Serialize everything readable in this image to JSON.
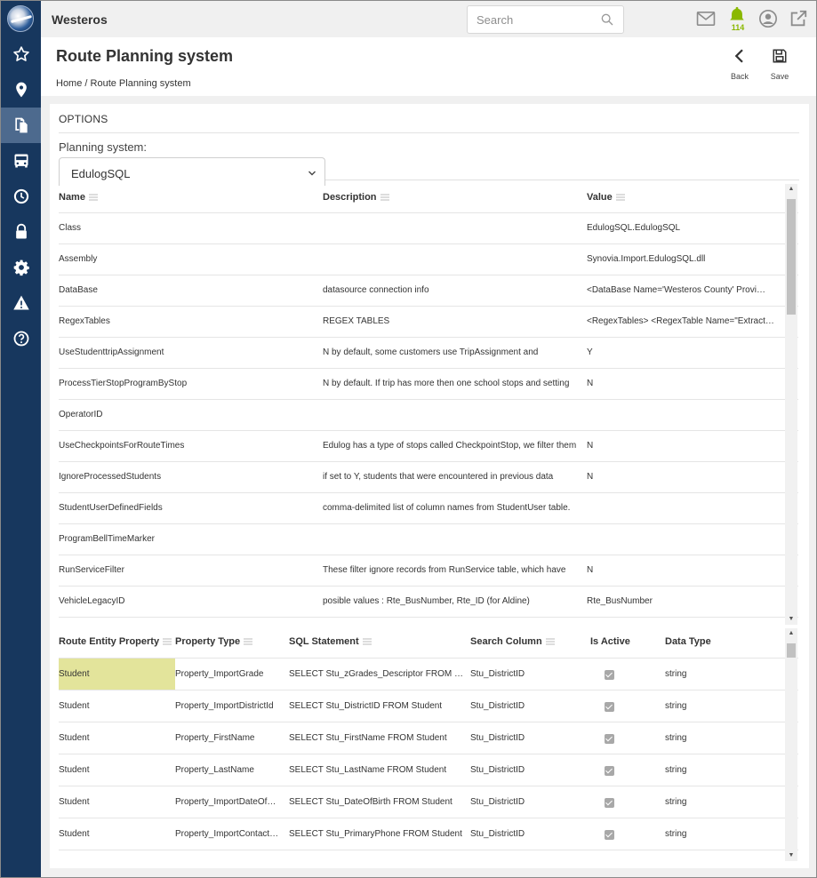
{
  "app": {
    "name": "Westeros"
  },
  "search": {
    "placeholder": "Search"
  },
  "notifications": {
    "count": "114"
  },
  "page": {
    "title": "Route Planning system",
    "breadcrumb": "Home / Route Planning system",
    "back_label": "Back",
    "save_label": "Save"
  },
  "options": {
    "title": "OPTIONS",
    "planning_system_label": "Planning system:",
    "planning_system_value": "EdulogSQL"
  },
  "settings_grid": {
    "columns": [
      "Name",
      "Description",
      "Value"
    ],
    "rows": [
      {
        "name": "Class",
        "description": "",
        "value": "EdulogSQL.EdulogSQL"
      },
      {
        "name": "Assembly",
        "description": "",
        "value": "Synovia.Import.EdulogSQL.dll"
      },
      {
        "name": "DataBase",
        "description": "datasource connection info",
        "value": "<DataBase Name='Westeros County' Provi…"
      },
      {
        "name": "RegexTables",
        "description": "REGEX TABLES",
        "value": "<RegexTables> <RegexTable Name=\"ExtractPr…"
      },
      {
        "name": "UseStudenttripAssignment",
        "description": "N by default, some customers use TripAssignment and",
        "value": "Y"
      },
      {
        "name": "ProcessTierStopProgramByStop",
        "description": "N by default. If trip has more then one school stops and setting",
        "value": "N"
      },
      {
        "name": "OperatorID",
        "description": "",
        "value": ""
      },
      {
        "name": "UseCheckpointsForRouteTimes",
        "description": "Edulog has a type of stops called CheckpointStop, we filter them",
        "value": "N"
      },
      {
        "name": "IgnoreProcessedStudents",
        "description": "if set to Y, students that were encountered in previous data",
        "value": "N"
      },
      {
        "name": "StudentUserDefinedFields",
        "description": "comma-delimited list of column names from StudentUser table.",
        "value": ""
      },
      {
        "name": "ProgramBellTimeMarker",
        "description": "",
        "value": ""
      },
      {
        "name": "RunServiceFilter",
        "description": "These filter ignore records from RunService table, which have",
        "value": "N"
      },
      {
        "name": "VehicleLegacyID",
        "description": "posible values : Rte_BusNumber, Rte_ID (for Aldine)",
        "value": "Rte_BusNumber"
      }
    ]
  },
  "entity_grid": {
    "columns": [
      "Route Entity Property",
      "Property Type",
      "SQL Statement",
      "Search Column",
      "Is Active",
      "Data Type"
    ],
    "rows": [
      {
        "entity": "Student",
        "type": "Property_ImportGrade",
        "sql": "SELECT Stu_zGrades_Descriptor FROM St…",
        "search": "Stu_DistrictID",
        "active": true,
        "datatype": "string"
      },
      {
        "entity": "Student",
        "type": "Property_ImportDistrictId",
        "sql": "SELECT Stu_DistrictID FROM Student",
        "search": "Stu_DistrictID",
        "active": true,
        "datatype": "string"
      },
      {
        "entity": "Student",
        "type": "Property_FirstName",
        "sql": "SELECT Stu_FirstName FROM Student",
        "search": "Stu_DistrictID",
        "active": true,
        "datatype": "string"
      },
      {
        "entity": "Student",
        "type": "Property_LastName",
        "sql": "SELECT Stu_LastName FROM Student",
        "search": "Stu_DistrictID",
        "active": true,
        "datatype": "string"
      },
      {
        "entity": "Student",
        "type": "Property_ImportDateOfB…",
        "sql": "SELECT Stu_DateOfBirth FROM Student",
        "search": "Stu_DistrictID",
        "active": true,
        "datatype": "string"
      },
      {
        "entity": "Student",
        "type": "Property_ImportContact…",
        "sql": "SELECT Stu_PrimaryPhone FROM Student",
        "search": "Stu_DistrictID",
        "active": true,
        "datatype": "string"
      }
    ]
  }
}
